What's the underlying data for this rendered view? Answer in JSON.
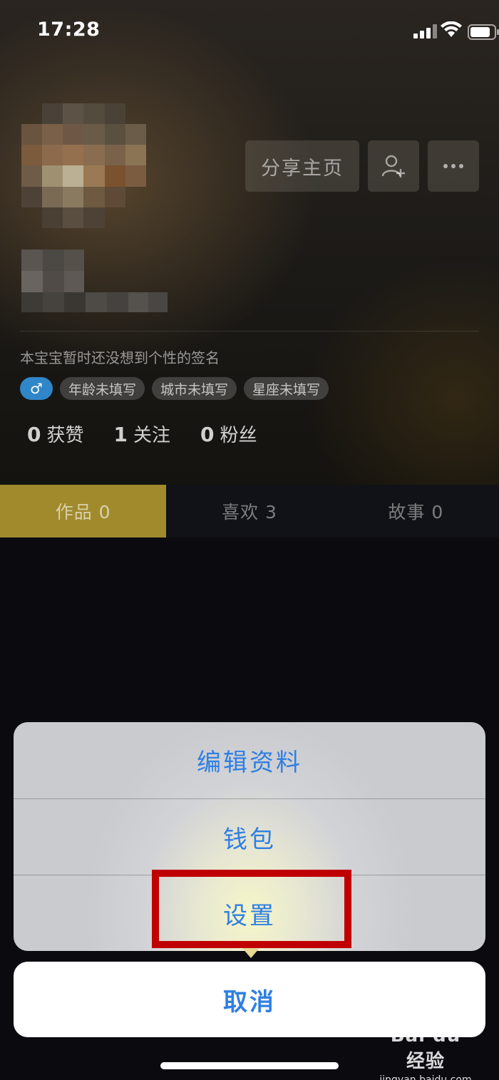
{
  "status_bar": {
    "time": "17:28"
  },
  "header": {
    "share_label": "分享主页",
    "add_friend_icon": "add-user-icon",
    "more_icon": "more-icon"
  },
  "profile": {
    "signature": "本宝宝暂时还没想到个性的签名",
    "gender_symbol": "♂",
    "tags": [
      "年龄未填写",
      "城市未填写",
      "星座未填写"
    ],
    "stats": [
      {
        "value": "0",
        "label": "获赞"
      },
      {
        "value": "1",
        "label": "关注"
      },
      {
        "value": "0",
        "label": "粉丝"
      }
    ]
  },
  "tabs": [
    {
      "label": "作品 0",
      "active": true
    },
    {
      "label": "喜欢 3",
      "active": false
    },
    {
      "label": "故事 0",
      "active": false
    }
  ],
  "action_sheet": {
    "items": [
      "编辑资料",
      "钱包",
      "设置"
    ],
    "cancel": "取消"
  },
  "colors": {
    "accent_blue": "#2f7fe3",
    "active_tab": "#a08a2c",
    "highlight": "#c00000"
  },
  "watermark": {
    "logo": "Bai du 经验",
    "url": "jingyan.baidu.com"
  }
}
